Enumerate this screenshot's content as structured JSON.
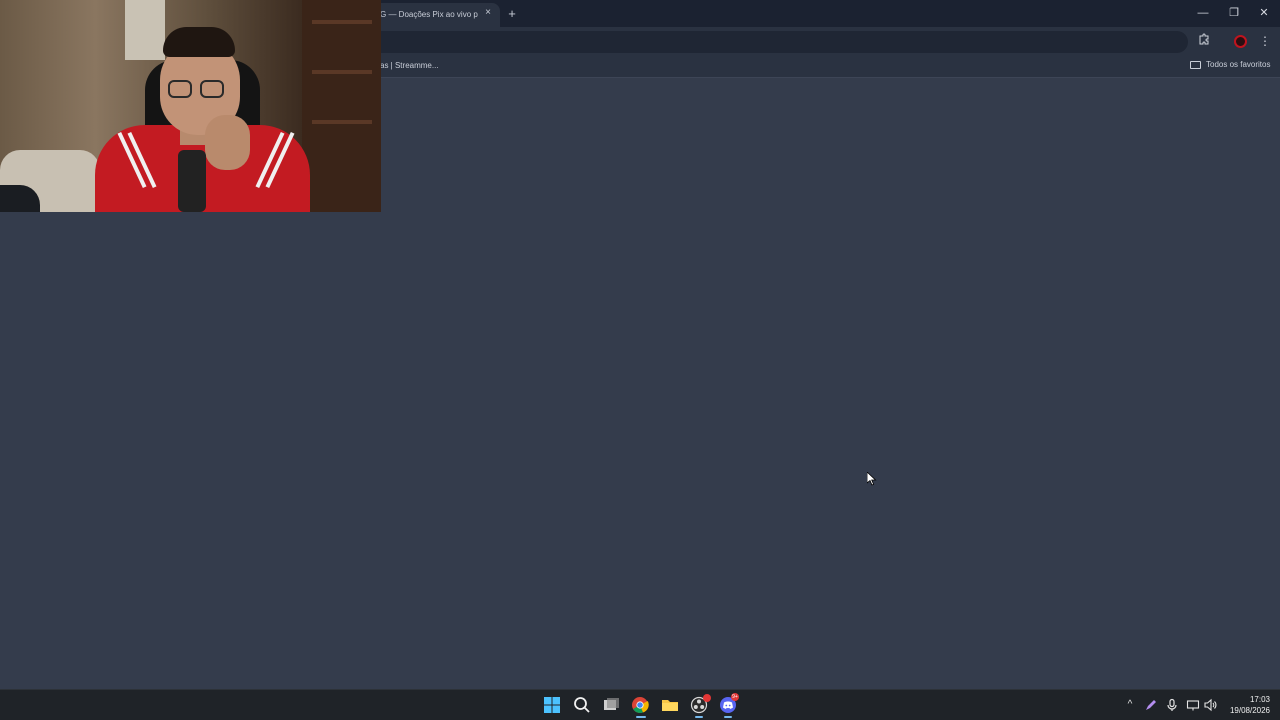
{
  "browser": {
    "tab_title": "G — Doações Pix ao vivo p",
    "tab_close_icon": "×",
    "newtab_icon": "+",
    "window_controls": {
      "minimize": "—",
      "restore": "❐",
      "close": "✕"
    },
    "toolbar": {
      "extensions_icon": "puzzle-icon",
      "menu_icon": "⋮"
    },
    "bookmarks": {
      "item": "as | Streamme...",
      "all_bookmarks": "Todos os favoritos"
    }
  },
  "taskbar": {
    "apps": [
      "windows-start",
      "search",
      "task-view",
      "chrome",
      "file-explorer",
      "obs",
      "discord"
    ],
    "discord_badge": "9+",
    "clock": {
      "time": "17:03",
      "date": "19/08/2026"
    }
  },
  "colors": {
    "page_bg": "#343c4c",
    "titlebar": "#1b2231",
    "toolbar": "#2a3241",
    "taskbar": "#1f2328",
    "accent": "#76b9ed"
  }
}
